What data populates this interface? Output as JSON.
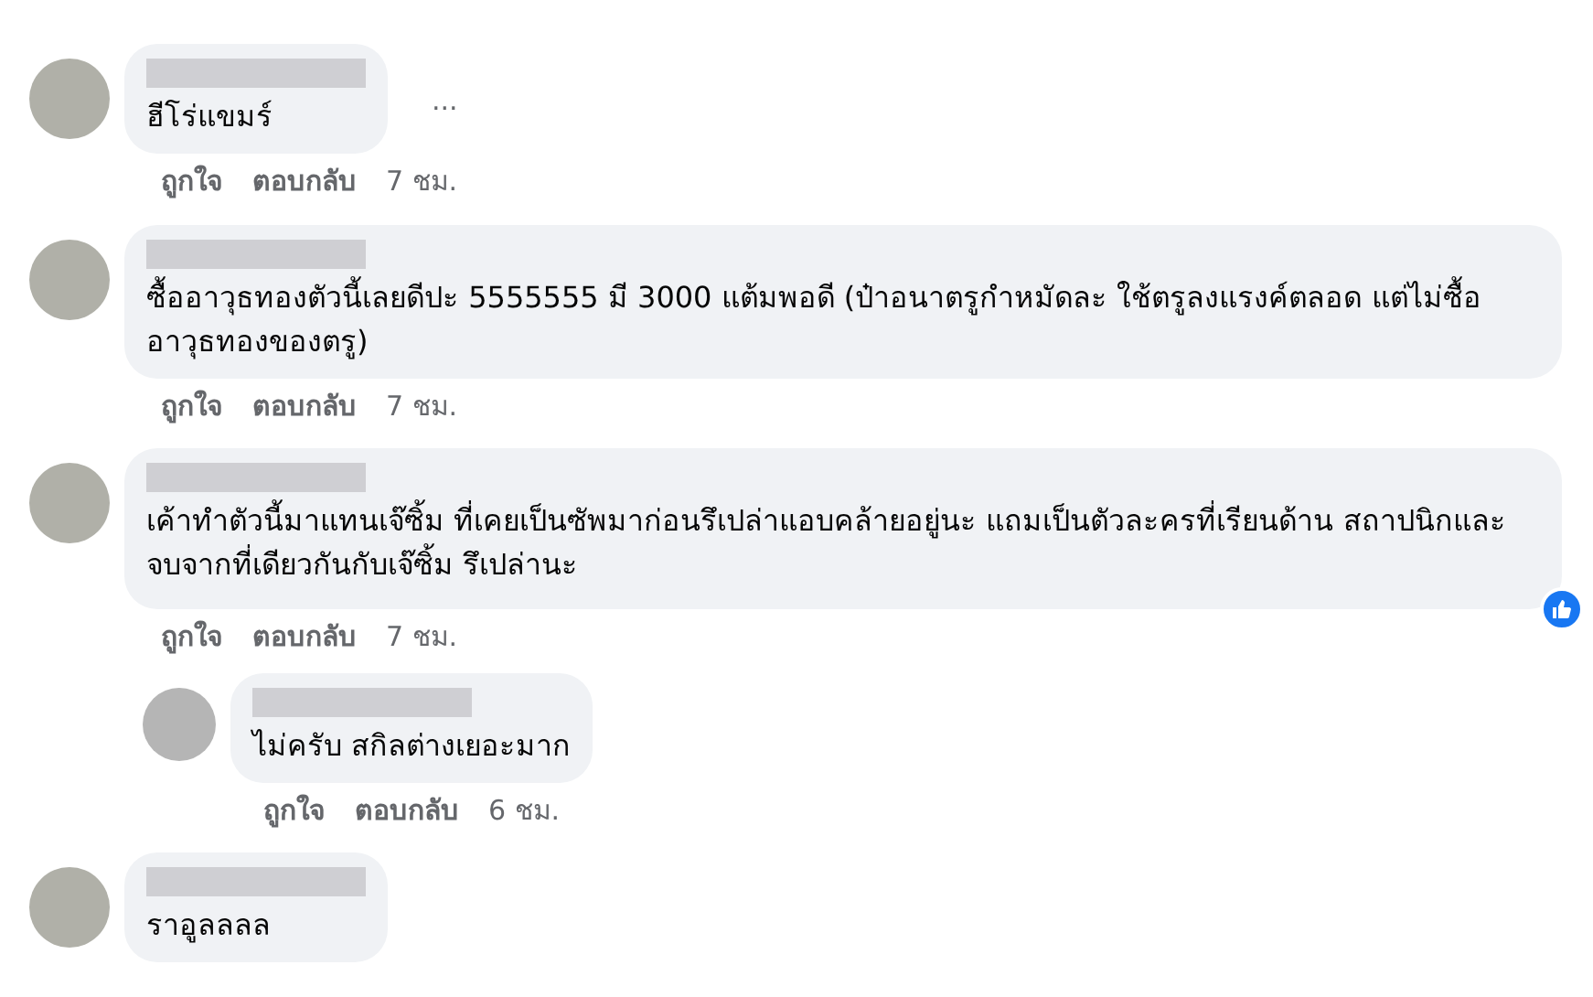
{
  "comments": [
    {
      "text": "ฮีโร่แขมร์",
      "more": "...",
      "like": "ถูกใจ",
      "reply": "ตอบกลับ",
      "time": "7 ชม.",
      "reacted": false
    },
    {
      "text": "ซื้ออาวุธทองตัวนี้เลยดีปะ 5555555 มี 3000 แต้มพอดี (ป๋าอนาตรูกำหมัดละ ใช้ตรูลงแรงค์ตลอด แต่ไม่ซื้ออาวุธทองของตรู)",
      "like": "ถูกใจ",
      "reply": "ตอบกลับ",
      "time": "7 ชม.",
      "reacted": false
    },
    {
      "text": "เค้าทำตัวนี้มาแทนเจ๊ซิ้ม ที่เคยเป็นซัพมาก่อนรึเปล่าแอบคล้ายอยู่นะ แถมเป็นตัวละครที่เรียนด้าน สถาปนิกและจบจากที่เดียวกันกับเจ๊ซิ้ม รึเปล่านะ",
      "like": "ถูกใจ",
      "reply": "ตอบกลับ",
      "time": "7 ชม.",
      "reacted": true,
      "children": [
        {
          "text": "ไม่ครับ สกิลต่างเยอะมาก",
          "like": "ถูกใจ",
          "reply": "ตอบกลับ",
          "time": "6 ชม.",
          "reacted": false
        }
      ]
    },
    {
      "text": "ราอูลลลล",
      "reacted": false
    }
  ]
}
